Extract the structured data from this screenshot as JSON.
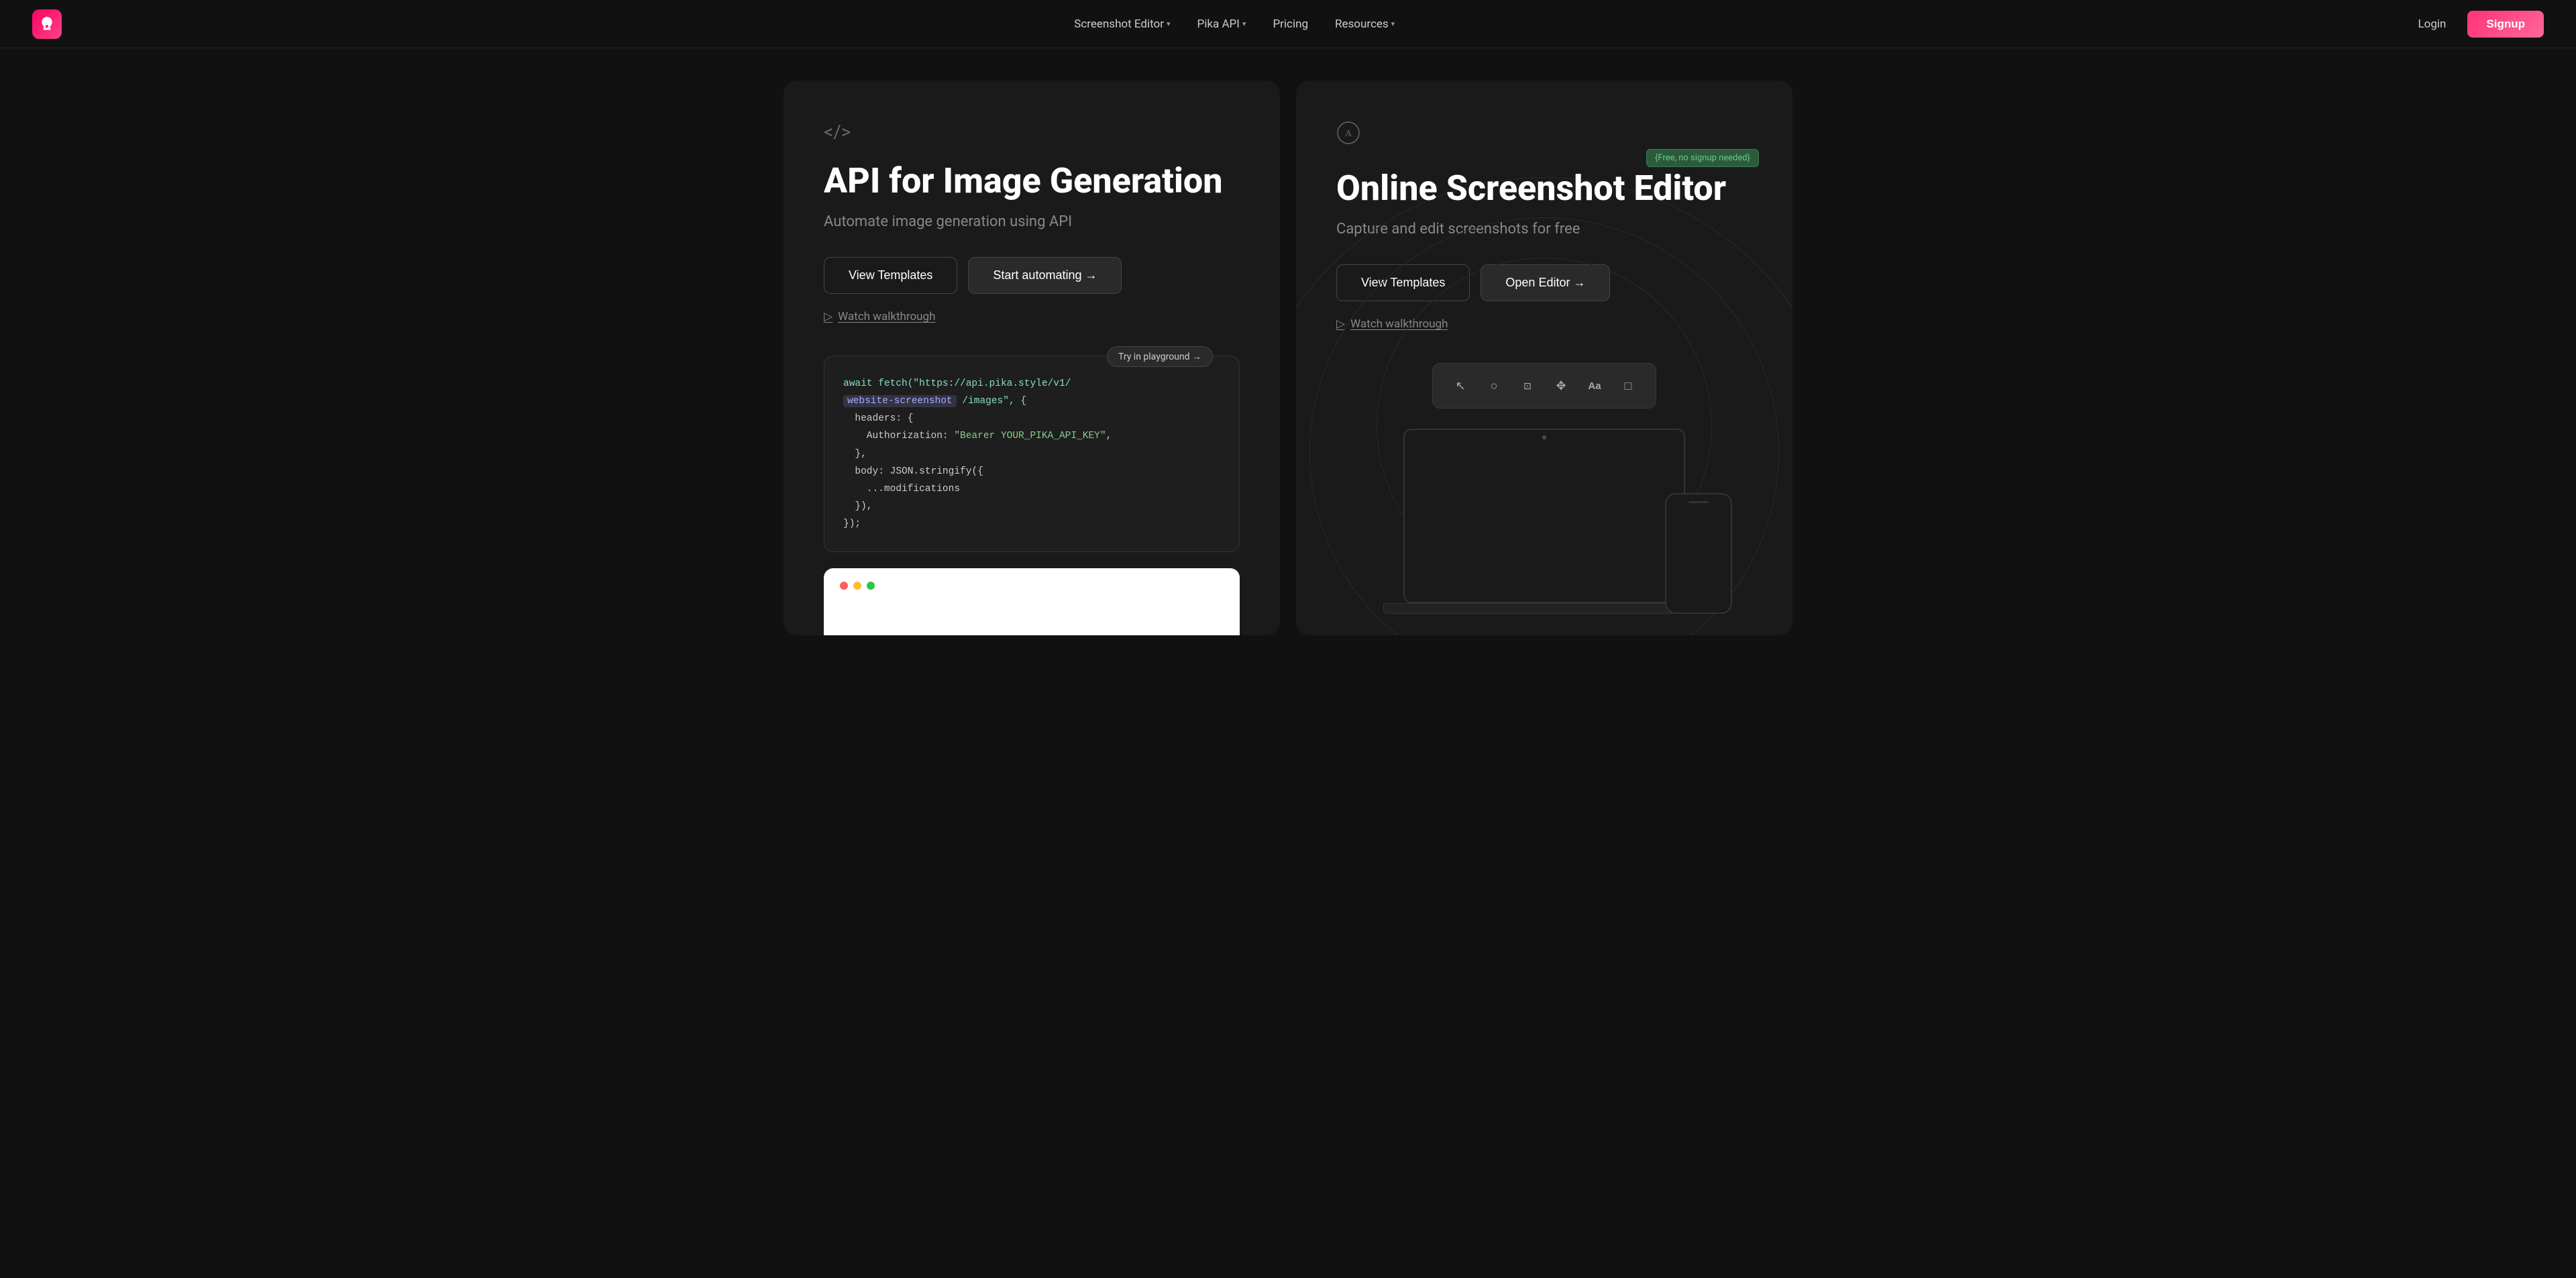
{
  "nav": {
    "logo_alt": "Pika Logo",
    "items": [
      {
        "label": "Screenshot Editor",
        "has_dropdown": true
      },
      {
        "label": "Pika API",
        "has_dropdown": true
      },
      {
        "label": "Pricing",
        "has_dropdown": false
      },
      {
        "label": "Resources",
        "has_dropdown": true
      }
    ],
    "login_label": "Login",
    "signup_label": "Signup"
  },
  "cards": {
    "left": {
      "icon": "</>",
      "title": "API for Image Generation",
      "subtitle": "Automate image generation using API",
      "btn_templates": "View Templates",
      "btn_automate": "Start automating →",
      "watch_label": "Watch walkthrough",
      "try_badge": "Try in playground →",
      "code_line1": "await fetch(\"https://api.pika.style/v1/",
      "code_highlight": "website-screenshot",
      "code_line2": "/images\", {",
      "code_line3": "  headers: {",
      "code_line4": "    Authorization: \"Bearer YOUR_PIKA_API_KEY\",",
      "code_line5": "  },",
      "code_line6": "  body: JSON.stringify({",
      "code_line7": "    ...modifications",
      "code_line8": "  }),",
      "code_line9": "});"
    },
    "right": {
      "icon": "Ⓐ",
      "title": "Online Screenshot Editor",
      "subtitle": "Capture and edit screenshots for free",
      "free_badge": "{Free, no signup needed}",
      "btn_templates": "View Templates",
      "btn_editor": "Open Editor →",
      "watch_label": "Watch walkthrough",
      "toolbar_items": [
        {
          "icon": "↖",
          "name": "cursor-tool"
        },
        {
          "icon": "○",
          "name": "circle-tool"
        },
        {
          "icon": "⊡",
          "name": "crop-tool"
        },
        {
          "icon": "✥",
          "name": "move-tool"
        },
        {
          "icon": "Aa",
          "name": "text-tool"
        },
        {
          "icon": "□",
          "name": "rect-tool"
        }
      ]
    }
  }
}
